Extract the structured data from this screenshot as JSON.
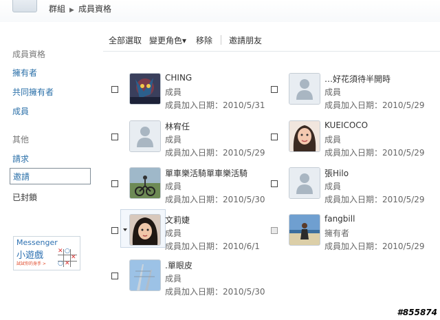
{
  "breadcrumb": {
    "parent": "群組",
    "current": "成員資格"
  },
  "sidebar": {
    "section1_title": "成員資格",
    "links1": [
      "擁有者",
      "共同擁有者",
      "成員"
    ],
    "section2_title": "其他",
    "requests": "請求",
    "invites": "邀請",
    "blocked": "已封鎖"
  },
  "ad": {
    "line1": "Messenger",
    "line2": "小遊戲",
    "line3": "試試你的身手 >"
  },
  "toolbar": {
    "select_all": "全部選取",
    "change_role": "變更角色▾",
    "remove": "移除",
    "invite_friends": "邀請朋友"
  },
  "members": [
    {
      "name": "CHING",
      "role": "成員",
      "date": "成員加入日期：2010/5/31",
      "avatar": "photo-artwork"
    },
    {
      "name": "…好花須待半開時",
      "role": "成員",
      "date": "成員加入日期：2010/5/29",
      "avatar": "default-person-icon"
    },
    {
      "name": "林宥任",
      "role": "成員",
      "date": "成員加入日期：2010/5/29",
      "avatar": "default-person-icon"
    },
    {
      "name": "KUEICOCO",
      "role": "成員",
      "date": "成員加入日期：2010/5/29",
      "avatar": "photo-woman"
    },
    {
      "name": "單車樂活騎單車樂活騎",
      "role": "成員",
      "date": "成員加入日期：2010/5/30",
      "avatar": "photo-cycling"
    },
    {
      "name": "張Hilo",
      "role": "成員",
      "date": "成員加入日期：2010/5/29",
      "avatar": "default-person-icon"
    },
    {
      "name": "文莉婕",
      "role": "成員",
      "date": "成員加入日期：2010/6/1",
      "avatar": "photo-girl"
    },
    {
      "name": "fangbill",
      "role": "擁有者",
      "date": "成員加入日期：2010/5/29",
      "avatar": "photo-beach"
    },
    {
      "name": ".單眼皮",
      "role": "成員",
      "date": "成員加入日期：2010/5/30",
      "avatar": "photo-sky"
    }
  ],
  "watermark": "#855874",
  "colors": {
    "link": "#2a6fa8",
    "text": "#444444",
    "border": "#c4ccd4"
  }
}
